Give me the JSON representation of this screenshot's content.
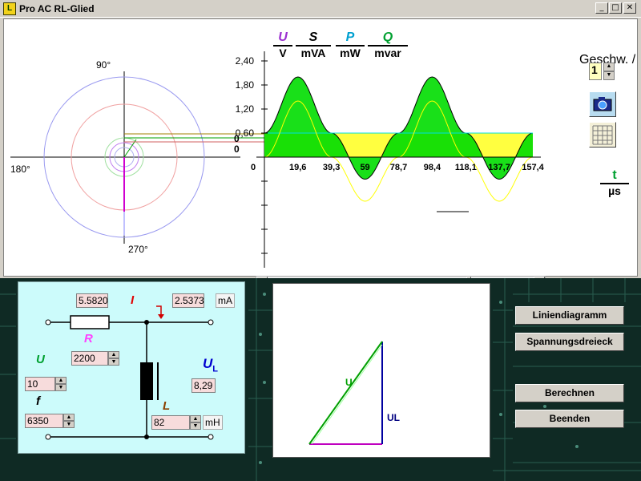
{
  "window": {
    "title": "Pro AC RL-Glied",
    "controls": {
      "minimize": "_",
      "maximize": "□",
      "close": "✕"
    }
  },
  "phasor": {
    "labels": {
      "top": "90°",
      "left": "180°",
      "bottom": "270°",
      "zero1": "0",
      "zero2": "0"
    }
  },
  "chart_header": {
    "items": [
      {
        "symbol": "U",
        "unit": "V",
        "color": "#9b30d0"
      },
      {
        "symbol": "S",
        "unit": "mVA",
        "color": "#000000"
      },
      {
        "symbol": "P",
        "unit": "mW",
        "color": "#00a0d0"
      },
      {
        "symbol": "Q",
        "unit": "mvar",
        "color": "#00a030"
      }
    ]
  },
  "time_axis": {
    "symbol": "t",
    "unit": "µs"
  },
  "chart_data": {
    "type": "line",
    "x": [
      0,
      19.6,
      39.3,
      59,
      78.7,
      98.4,
      118.1,
      137.7,
      157.4
    ],
    "xticks": [
      "0",
      "19,6",
      "39,3",
      "59",
      "78,7",
      "98,4",
      "118,1",
      "137,7",
      "157,4"
    ],
    "yticks": [
      "2,40",
      "1,80",
      "1,20",
      "0,60"
    ],
    "ylim": [
      -2.4,
      2.4
    ],
    "xlim": [
      0,
      157.4
    ],
    "series": [
      {
        "name": "S",
        "color": "#00cc00",
        "values": [
          0.6,
          2.0,
          0.6,
          -0.55,
          0.6,
          2.0,
          0.6,
          -0.55,
          0.6
        ]
      },
      {
        "name": "P",
        "color": "#00e0e0",
        "values": [
          0.6,
          0.6,
          0.6,
          0.6,
          0.6,
          0.6,
          0.6,
          0.6,
          0.6
        ]
      },
      {
        "name": "Q",
        "color": "#ffff00",
        "values": [
          0,
          1.4,
          0,
          -1.1,
          0,
          1.4,
          0,
          -1.1,
          0
        ]
      }
    ]
  },
  "speed": {
    "label": "Geschw. /",
    "value": "1",
    "up": "▲",
    "down": "▼"
  },
  "circuit": {
    "current_value": "5.5820",
    "current_symbol": "I",
    "current_reading": "2.5373",
    "current_unit": "mA",
    "r_symbol": "R",
    "r_value": "2200",
    "u_symbol": "U",
    "u_value": "10",
    "f_symbol": "f",
    "f_value": "6350",
    "ul_symbol": "U",
    "ul_sub": "L",
    "ul_value": "8,29",
    "l_symbol": "L",
    "l_value": "82",
    "l_unit": "mH",
    "up": "▲",
    "down": "▼"
  },
  "triangle": {
    "u_label": "U",
    "ul_label": "UL"
  },
  "buttons": {
    "liniendiagramm": "Liniendiagramm",
    "spannungsdreieck": "Spannungsdreieck",
    "berechnen": "Berechnen",
    "beenden": "Beenden"
  },
  "scroll": {
    "left": "◀",
    "right": "▶"
  }
}
